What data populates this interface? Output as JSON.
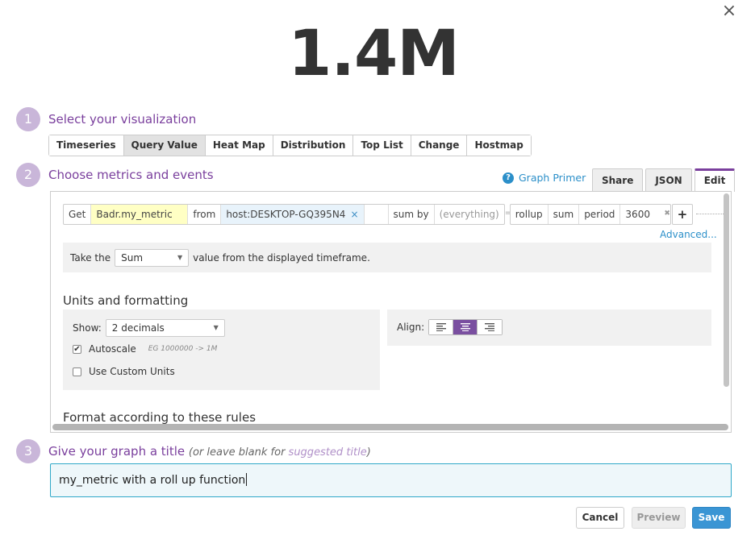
{
  "dialog": {
    "close_label": "×"
  },
  "value": {
    "display": "1.4M"
  },
  "steps": [
    {
      "number": "1",
      "title": "Select your visualization"
    },
    {
      "number": "2",
      "title": "Choose metrics and events"
    },
    {
      "number": "3",
      "title": "Give your graph a title",
      "hint_prefix": "(or leave blank for ",
      "hint_link": "suggested title",
      "hint_suffix": ")"
    }
  ],
  "viz_tabs": [
    {
      "label": "Timeseries",
      "active": false
    },
    {
      "label": "Query Value",
      "active": true
    },
    {
      "label": "Heat Map",
      "active": false
    },
    {
      "label": "Distribution",
      "active": false
    },
    {
      "label": "Top List",
      "active": false
    },
    {
      "label": "Change",
      "active": false
    },
    {
      "label": "Hostmap",
      "active": false
    }
  ],
  "graph_primer": {
    "icon": "question-icon",
    "label": "Graph Primer"
  },
  "editor_tabs": [
    {
      "label": "Share",
      "active": false
    },
    {
      "label": "JSON",
      "active": false
    },
    {
      "label": "Edit",
      "active": true
    }
  ],
  "query": {
    "get_label": "Get",
    "metric": "Badr.my_metric",
    "from_label": "from",
    "host": "host:DESKTOP-GQ395N4",
    "host_remove": "×",
    "sum_by_label": "sum by",
    "sum_by_value": "(everything)",
    "equals": "=",
    "rollup_label": "rollup",
    "rollup_fn": "sum",
    "period_label": "period",
    "period_value": "3600",
    "period_clear": "✖",
    "add_label": "+",
    "code_label": "</>",
    "remove_label": "✕",
    "advanced_label": "Advanced..."
  },
  "timeframe": {
    "prefix": "Take the",
    "aggregation": "Sum",
    "suffix": "value from the displayed timeframe."
  },
  "units": {
    "title": "Units and formatting",
    "show_label": "Show:",
    "show_value": "2 decimals",
    "autoscale_label": "Autoscale",
    "autoscale_checked": true,
    "autoscale_hint": "EG 1000000 -> 1M",
    "custom_units_label": "Use Custom Units",
    "custom_units_checked": false,
    "align_label": "Align:",
    "align_options": [
      "left",
      "center",
      "right"
    ],
    "align_selected": "center"
  },
  "format_title": "Format according to these rules",
  "graph_title": {
    "value": "my_metric with a roll up function"
  },
  "buttons": {
    "cancel": "Cancel",
    "preview": "Preview",
    "save": "Save"
  },
  "colors": {
    "accent": "#7a3f9d",
    "link": "#2b8fc9",
    "save": "#3a95d4",
    "step_circle": "#c9b6d9"
  }
}
